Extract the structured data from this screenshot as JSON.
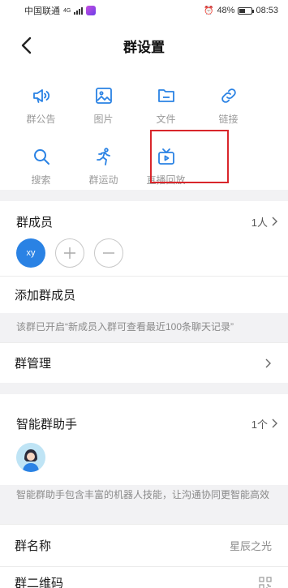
{
  "status_bar": {
    "carrier": "中国联通",
    "network": "4G",
    "battery": "48%",
    "battery_level": 0.48,
    "time": "08:53"
  },
  "nav": {
    "title": "群设置"
  },
  "features": {
    "row1": [
      {
        "label": "群公告",
        "icon": "megaphone-icon"
      },
      {
        "label": "图片",
        "icon": "image-icon"
      },
      {
        "label": "文件",
        "icon": "folder-icon"
      },
      {
        "label": "链接",
        "icon": "link-icon"
      }
    ],
    "row2": [
      {
        "label": "搜索",
        "icon": "search-icon"
      },
      {
        "label": "群运动",
        "icon": "running-icon"
      },
      {
        "label": "直播回放",
        "icon": "tv-play-icon"
      }
    ]
  },
  "members": {
    "title": "群成员",
    "count": "1人",
    "avatar_text": "xy"
  },
  "add_member": {
    "label": "添加群成员"
  },
  "notice": {
    "text": "该群已开启“新成员入群可查看最近100条聊天记录”"
  },
  "manage": {
    "label": "群管理"
  },
  "assistant": {
    "title": "智能群助手",
    "count": "1个",
    "description": "智能群助手包含丰富的机器人技能，让沟通协同更智能高效"
  },
  "group_name": {
    "label": "群名称",
    "value": "星辰之光"
  },
  "qr": {
    "label": "群二维码"
  },
  "colors": {
    "accent": "#2a82e4",
    "highlight": "#d9262b"
  }
}
